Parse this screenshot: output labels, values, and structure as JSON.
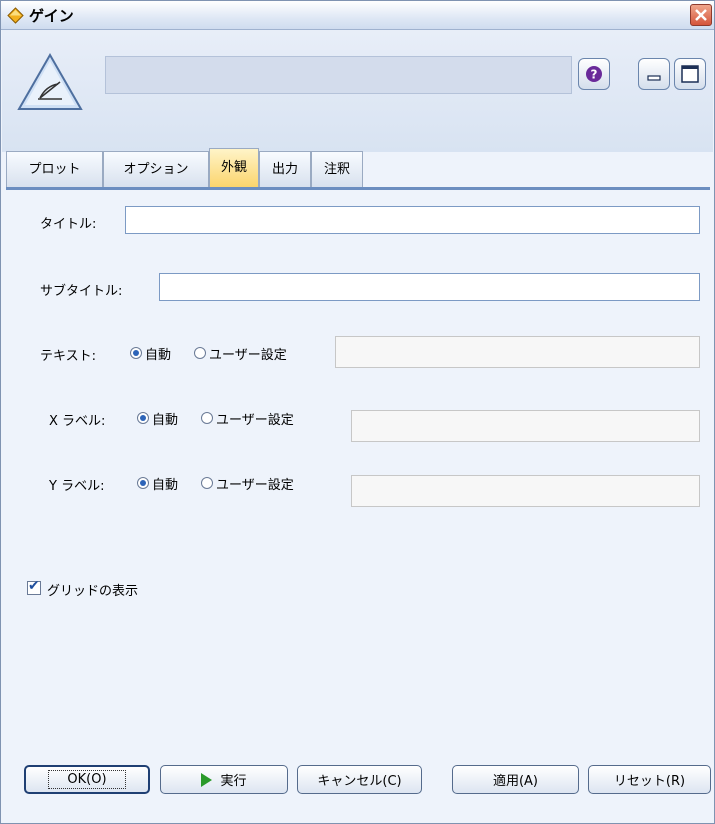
{
  "window": {
    "title": "ゲイン"
  },
  "tabs": [
    {
      "label": "プロット",
      "active": false
    },
    {
      "label": "オプション",
      "active": false
    },
    {
      "label": "外観",
      "active": true
    },
    {
      "label": "出力",
      "active": false
    },
    {
      "label": "注釈",
      "active": false
    }
  ],
  "form": {
    "title": {
      "label": "タイトル:",
      "value": ""
    },
    "subtitle": {
      "label": "サブタイトル:",
      "value": ""
    },
    "text": {
      "label": "テキスト:",
      "auto": "自動",
      "custom": "ユーザー設定",
      "selected": "auto",
      "value": ""
    },
    "xlabel": {
      "label": "X ラベル:",
      "auto": "自動",
      "custom": "ユーザー設定",
      "selected": "auto",
      "value": ""
    },
    "ylabel": {
      "label": "Y ラベル:",
      "auto": "自動",
      "custom": "ユーザー設定",
      "selected": "auto",
      "value": ""
    },
    "grid": {
      "label": "グリッドの表示",
      "checked": true
    }
  },
  "buttons": {
    "ok": "OK(O)",
    "run": "実行",
    "cancel": "キャンセル(C)",
    "apply": "適用(A)",
    "reset": "リセット(R)"
  },
  "icons": {
    "app": "diamond-node-icon",
    "node": "gains-chart-triangle-icon",
    "help": "help-icon",
    "minimize": "minimize-icon",
    "maximize": "maximize-icon",
    "close": "close-icon",
    "run": "play-icon"
  },
  "colors": {
    "active_tab": "#fbd56d",
    "tab_rule": "#6c8ec0",
    "help_icon": "#6a2a9a",
    "run_icon": "#2a9a2a"
  }
}
